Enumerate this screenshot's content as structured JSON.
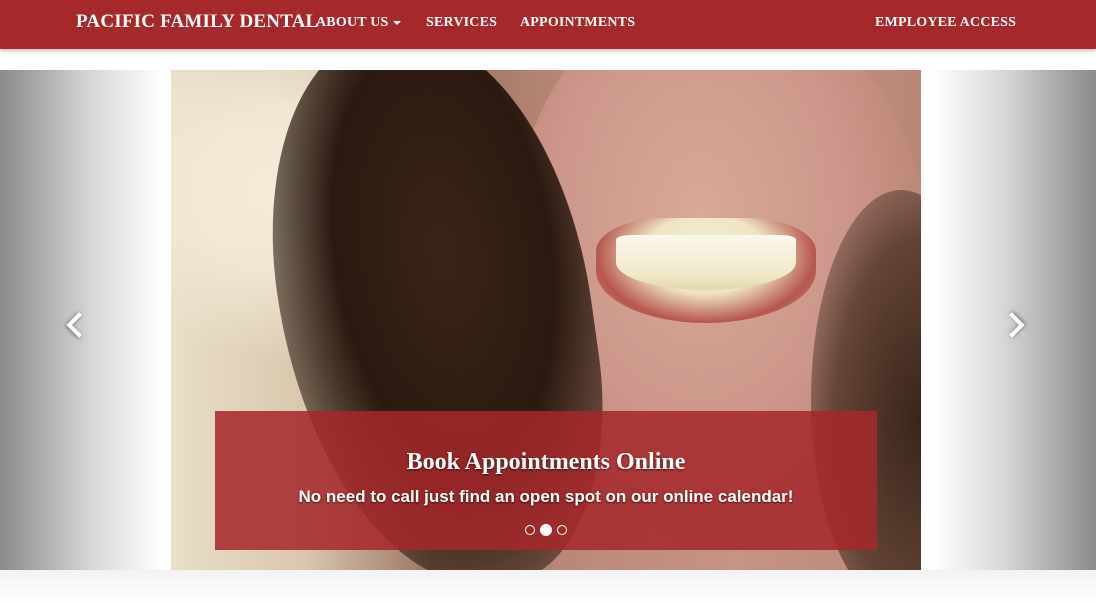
{
  "navbar": {
    "brand": "PACIFIC FAMILY DENTAL",
    "items": [
      {
        "label": "ABOUT US",
        "dropdown": true
      },
      {
        "label": "SERVICES"
      },
      {
        "label": "APPOINTMENTS"
      }
    ],
    "right_item": "EMPLOYEE ACCESS",
    "color": "#a5282b"
  },
  "carousel": {
    "caption": {
      "title": "Book Appointments Online",
      "text": "No need to call just find an open spot on our online calendar!"
    },
    "slide_count": 3,
    "active_slide": 2,
    "controls": {
      "prev_icon": "chevron-left-icon",
      "next_icon": "chevron-right-icon"
    },
    "image": "smiling-woman-photo"
  }
}
